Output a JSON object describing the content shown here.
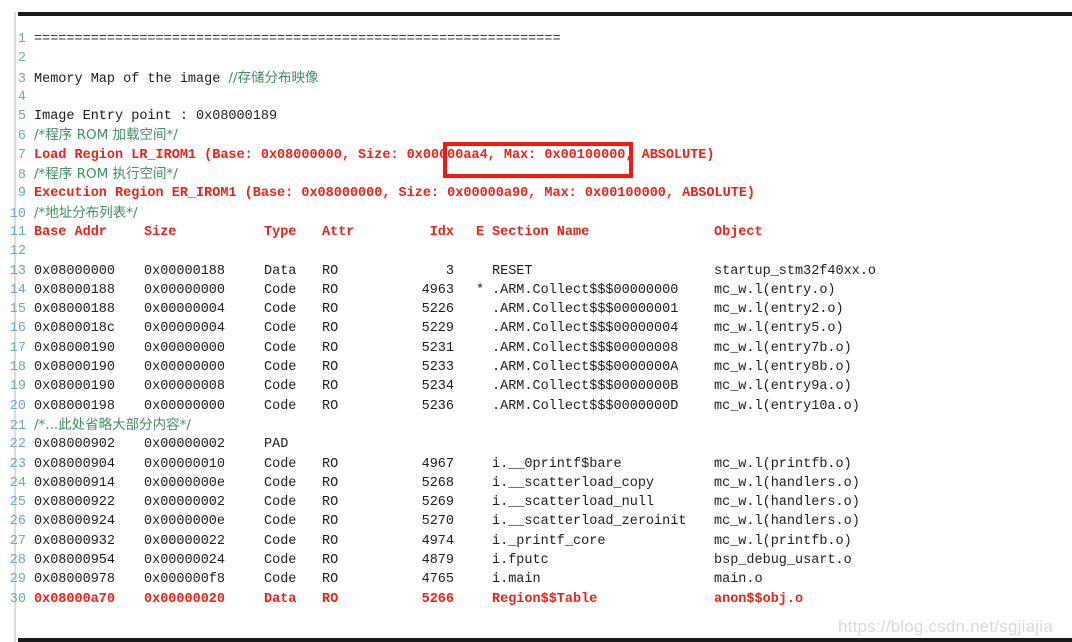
{
  "document": {
    "title": "Memory Map of the image",
    "watermark": "https://blog.csdn.net/sgjiajia",
    "colors": {
      "line_number": "#6ca6c1",
      "comment_green": "#3f8f5f",
      "keyword_red": "#e8231a",
      "highlight_box": "#ee1c10",
      "text": "#1c1c1c",
      "background": "#ffffff"
    }
  },
  "highlight": {
    "text": "Size: 0x00000aa4,",
    "target_line": 7
  },
  "columns": {
    "base_addr": "Base Addr",
    "size": "Size",
    "type": "Type",
    "attr": "Attr",
    "idx": "Idx",
    "e": "E",
    "section_name": "Section Name",
    "object": "Object"
  },
  "lines": [
    {
      "n": "1",
      "kind": "eq",
      "text": "================================================================="
    },
    {
      "n": "2",
      "kind": "plain",
      "text": ""
    },
    {
      "n": "3",
      "kind": "mixed",
      "plain": "Memory Map of the image ",
      "comment": "//存储分布映像"
    },
    {
      "n": "4",
      "kind": "plain",
      "text": ""
    },
    {
      "n": "5",
      "kind": "plain",
      "text": "Image Entry point : 0x08000189"
    },
    {
      "n": "6",
      "kind": "comment",
      "text": "/*程序 ROM 加载空间*/"
    },
    {
      "n": "7",
      "kind": "red",
      "text": "Load Region LR_IROM1 (Base: 0x08000000, Size: 0x00000aa4, Max: 0x00100000, ABSOLUTE)"
    },
    {
      "n": "8",
      "kind": "comment",
      "text": "/*程序 ROM 执行空间*/"
    },
    {
      "n": "9",
      "kind": "red",
      "text": "Execution Region ER_IROM1 (Base: 0x08000000, Size: 0x00000a90, Max: 0x00100000, ABSOLUTE)"
    },
    {
      "n": "10",
      "kind": "comment",
      "text": "/*地址分布列表*/"
    },
    {
      "n": "11",
      "kind": "header"
    },
    {
      "n": "12",
      "kind": "plain",
      "text": ""
    },
    {
      "n": "13",
      "kind": "row",
      "base": "0x08000000",
      "size": "0x00000188",
      "type": "Data",
      "attr": "RO",
      "idx": "3",
      "e": "",
      "section": "RESET",
      "object": "startup_stm32f40xx.o"
    },
    {
      "n": "14",
      "kind": "row",
      "base": "0x08000188",
      "size": "0x00000000",
      "type": "Code",
      "attr": "RO",
      "idx": "4963",
      "e": "*",
      "section": ".ARM.Collect$$$00000000",
      "object": "mc_w.l(entry.o)"
    },
    {
      "n": "15",
      "kind": "row",
      "base": "0x08000188",
      "size": "0x00000004",
      "type": "Code",
      "attr": "RO",
      "idx": "5226",
      "e": "",
      "section": ".ARM.Collect$$$00000001",
      "object": "mc_w.l(entry2.o)"
    },
    {
      "n": "16",
      "kind": "row",
      "base": "0x0800018c",
      "size": "0x00000004",
      "type": "Code",
      "attr": "RO",
      "idx": "5229",
      "e": "",
      "section": ".ARM.Collect$$$00000004",
      "object": "mc_w.l(entry5.o)"
    },
    {
      "n": "17",
      "kind": "row",
      "base": "0x08000190",
      "size": "0x00000000",
      "type": "Code",
      "attr": "RO",
      "idx": "5231",
      "e": "",
      "section": ".ARM.Collect$$$00000008",
      "object": "mc_w.l(entry7b.o)"
    },
    {
      "n": "18",
      "kind": "row",
      "base": "0x08000190",
      "size": "0x00000000",
      "type": "Code",
      "attr": "RO",
      "idx": "5233",
      "e": "",
      "section": ".ARM.Collect$$$0000000A",
      "object": "mc_w.l(entry8b.o)"
    },
    {
      "n": "19",
      "kind": "row",
      "base": "0x08000190",
      "size": "0x00000008",
      "type": "Code",
      "attr": "RO",
      "idx": "5234",
      "e": "",
      "section": ".ARM.Collect$$$0000000B",
      "object": "mc_w.l(entry9a.o)"
    },
    {
      "n": "20",
      "kind": "row",
      "base": "0x08000198",
      "size": "0x00000000",
      "type": "Code",
      "attr": "RO",
      "idx": "5236",
      "e": "",
      "section": ".ARM.Collect$$$0000000D",
      "object": "mc_w.l(entry10a.o)"
    },
    {
      "n": "21",
      "kind": "comment",
      "text": "/*...此处省略大部分内容*/"
    },
    {
      "n": "22",
      "kind": "row",
      "base": "0x08000902",
      "size": "0x00000002",
      "type": "PAD",
      "attr": "",
      "idx": "",
      "e": "",
      "section": "",
      "object": ""
    },
    {
      "n": "23",
      "kind": "row",
      "base": "0x08000904",
      "size": "0x00000010",
      "type": "Code",
      "attr": "RO",
      "idx": "4967",
      "e": "",
      "section": "i.__0printf$bare",
      "object": "mc_w.l(printfb.o)"
    },
    {
      "n": "24",
      "kind": "row",
      "base": "0x08000914",
      "size": "0x0000000e",
      "type": "Code",
      "attr": "RO",
      "idx": "5268",
      "e": "",
      "section": "i.__scatterload_copy",
      "object": "mc_w.l(handlers.o)"
    },
    {
      "n": "25",
      "kind": "row",
      "base": "0x08000922",
      "size": "0x00000002",
      "type": "Code",
      "attr": "RO",
      "idx": "5269",
      "e": "",
      "section": "i.__scatterload_null",
      "object": "mc_w.l(handlers.o)"
    },
    {
      "n": "26",
      "kind": "row",
      "base": "0x08000924",
      "size": "0x0000000e",
      "type": "Code",
      "attr": "RO",
      "idx": "5270",
      "e": "",
      "section": "i.__scatterload_zeroinit",
      "object": "mc_w.l(handlers.o)"
    },
    {
      "n": "27",
      "kind": "row",
      "base": "0x08000932",
      "size": "0x00000022",
      "type": "Code",
      "attr": "RO",
      "idx": "4974",
      "e": "",
      "section": "i._printf_core",
      "object": "mc_w.l(printfb.o)"
    },
    {
      "n": "28",
      "kind": "row",
      "base": "0x08000954",
      "size": "0x00000024",
      "type": "Code",
      "attr": "RO",
      "idx": "4879",
      "e": "",
      "section": "i.fputc",
      "object": "bsp_debug_usart.o"
    },
    {
      "n": "29",
      "kind": "row",
      "base": "0x08000978",
      "size": "0x000000f8",
      "type": "Code",
      "attr": "RO",
      "idx": "4765",
      "e": "",
      "section": "i.main",
      "object": "main.o"
    },
    {
      "n": "30",
      "kind": "row-red",
      "base": "0x08000a70",
      "size": "0x00000020",
      "type": "Data",
      "attr": "RO",
      "idx": "5266",
      "e": "",
      "section": "Region$$Table",
      "object": "anon$$obj.o"
    }
  ]
}
